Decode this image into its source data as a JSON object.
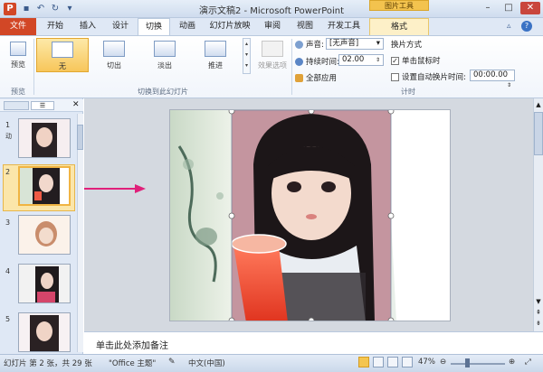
{
  "window": {
    "title": "演示文稿2 - Microsoft PowerPoint",
    "tool_context": "图片工具",
    "app_icon": "P"
  },
  "tabs": {
    "file": "文件",
    "items": [
      "开始",
      "插入",
      "设计",
      "切换",
      "动画",
      "幻灯片放映",
      "审阅",
      "视图",
      "开发工具",
      "格式"
    ]
  },
  "ribbon": {
    "preview_label": "预览",
    "preview_group": "预览",
    "transitions": [
      "无",
      "切出",
      "淡出",
      "推进"
    ],
    "transitions_group": "切换到此幻灯片",
    "effect_options": "效果选项",
    "sound_label": "声音:",
    "sound_value": "[无声音]",
    "duration_label": "持续时间:",
    "duration_value": "02.00",
    "apply_all": "全部应用",
    "advance_title": "换片方式",
    "on_click_label": "单击鼠标时",
    "auto_label": "设置自动换片时间:",
    "auto_value": "00:00.00",
    "timing_group": "计时"
  },
  "thumbnails": {
    "numbers": [
      "1",
      "2",
      "3",
      "4",
      "5"
    ],
    "slide1_mark": "动"
  },
  "notes_placeholder": "单击此处添加备注",
  "status": {
    "slide_info": "幻灯片 第 2 张，共 29 张",
    "theme": "\"Office 主题\"",
    "language": "中文(中国)",
    "zoom": "47%"
  },
  "colors": {
    "file_tab": "#d24726",
    "selection": "#f0b442",
    "arrow": "#e0207a"
  }
}
